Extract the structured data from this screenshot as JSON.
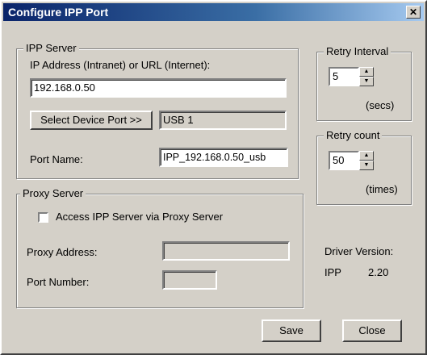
{
  "window": {
    "title": "Configure IPP Port",
    "close_glyph": "✕"
  },
  "ipp_server": {
    "legend": "IPP Server",
    "address_label": "IP Address (Intranet) or URL (Internet):",
    "address_value": "192.168.0.50",
    "select_port_label": "Select Device Port >>",
    "device_port_value": "USB 1",
    "port_name_label": "Port Name:",
    "port_name_value": "IPP_192.168.0.50_usb"
  },
  "proxy_server": {
    "legend": "Proxy Server",
    "checkbox_label": "Access IPP Server via Proxy Server",
    "checkbox_checked": false,
    "address_label": "Proxy Address:",
    "address_value": "",
    "port_label": "Port Number:",
    "port_value": ""
  },
  "retry_interval": {
    "legend": "Retry Interval",
    "value": "5",
    "unit": "(secs)"
  },
  "retry_count": {
    "legend": "Retry count",
    "value": "50",
    "unit": "(times)"
  },
  "driver": {
    "label": "Driver Version:",
    "name": "IPP",
    "version": "2.20"
  },
  "buttons": {
    "save": "Save",
    "close": "Close"
  }
}
